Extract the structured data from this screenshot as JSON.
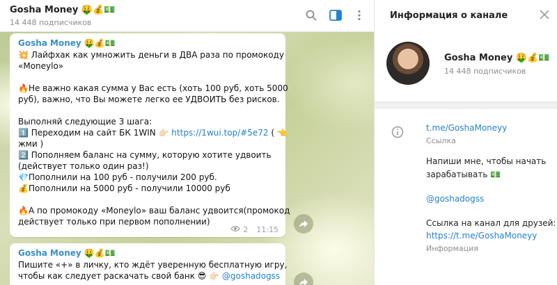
{
  "chat": {
    "title": "Gosha Money 🤑💰💵",
    "subscribers": "14 448 подписчиков"
  },
  "messages": [
    {
      "author": "Gosha Money 🤑💰💵",
      "lines": [
        "💥 Лайфхак как умножить деньги в ДВА раза по промокоду",
        "«Moneylo»",
        "",
        "🔥Не важно какая сумма у Вас есть (хоть 100 руб, хоть 5000",
        "руб), важно, что Вы можете легко ее УДВОИТЬ без рисков.",
        "",
        "Выполняй следующие 3 шага:"
      ],
      "step1_prefix": "1️⃣ Переходим на сайт БК 1WIN 👉🏻 ",
      "step1_link": "https://1wui.top/#5e72",
      "step1_suffix": " ( 👈",
      "lines2": [
        "жми )",
        "2️⃣ Пополняем баланс на сумму, которую хотите удвоить",
        "(действует только один раз!)",
        "💎Пополнили на 100 руб - получили 200 руб.",
        "💰Пополнили на 5000 руб - получили 10000 руб",
        "",
        "🔥А по промокоду «Moneylo» ваш баланс удвоится(промокод",
        "действует только при первом пополнении)"
      ],
      "views": "2",
      "time": "11:15"
    },
    {
      "author": "Gosha Money 🤑💰💵",
      "lines": [
        "Пишите «+» в личку, кто ждёт уверенную бесплатную игру,"
      ],
      "last_prefix": "чтобы как следует раскачать свой банк 😎 👉🏻 ",
      "last_link": "@goshadogss"
    }
  ],
  "panel": {
    "title": "Информация о канале",
    "channel_name": "Gosha Money 🤑💰💵",
    "subscribers": "14 448 подписчиков",
    "link": "t.me/GoshaMoneyy",
    "link_label": "Ссылка",
    "desc_line1": "Напиши мне, чтобы начать",
    "desc_line2": "зарабатывать 💵",
    "desc_handle": "@goshadogss",
    "friends_line": "Ссылка на канал для друзей:",
    "friends_link": "https://t.me/GoshaMoneyy",
    "info_label": "Информация"
  },
  "colors": {
    "accent": "#2481cc",
    "author": "#3a8fc4"
  },
  "icons": [
    "search-icon",
    "sidebar-toggle-icon",
    "more-vertical-icon",
    "close-icon",
    "info-icon",
    "eye-icon",
    "share-icon"
  ]
}
